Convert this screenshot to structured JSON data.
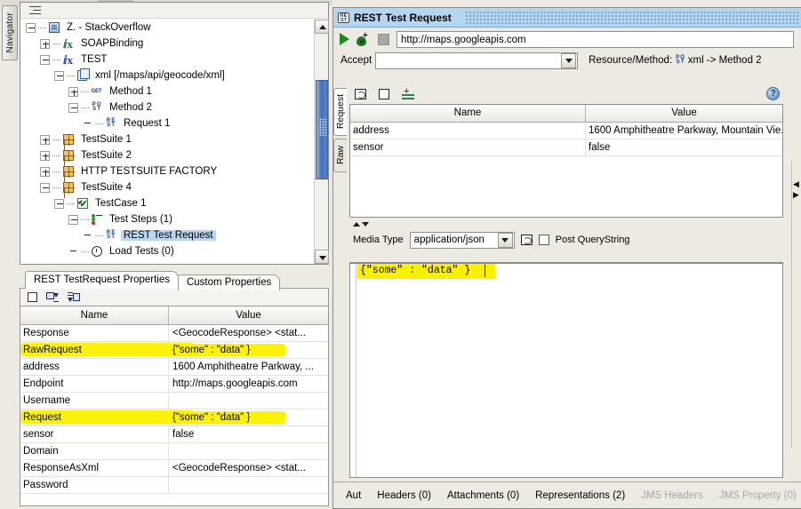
{
  "app": {
    "navigator_tab": "Navigator"
  },
  "tree": {
    "items": [
      {
        "label": "Z. - StackOverflow",
        "icon": "project-icon",
        "indent": 0,
        "expander": "minus",
        "selected": false
      },
      {
        "label": "SOAPBinding",
        "icon": "interface-icon",
        "indent": 1,
        "expander": "plus",
        "selected": false
      },
      {
        "label": "TEST",
        "icon": "interface-icon-blue",
        "indent": 1,
        "expander": "minus",
        "selected": false
      },
      {
        "label": "xml [/maps/api/geocode/xml]",
        "icon": "resource-icon",
        "indent": 2,
        "expander": "minus",
        "selected": false
      },
      {
        "label": "Method 1",
        "icon": "get-method-icon",
        "indent": 3,
        "expander": "plus",
        "selected": false
      },
      {
        "label": "Method 2",
        "icon": "post-method-icon",
        "indent": 3,
        "expander": "minus",
        "selected": false
      },
      {
        "label": "Request 1",
        "icon": "rest-request-icon",
        "indent": 4,
        "expander": "none",
        "selected": false
      },
      {
        "label": "TestSuite 1",
        "icon": "testsuite-icon",
        "indent": 1,
        "expander": "plus",
        "selected": false
      },
      {
        "label": "TestSuite 2",
        "icon": "testsuite-icon",
        "indent": 1,
        "expander": "plus",
        "selected": false
      },
      {
        "label": "HTTP TESTSUITE FACTORY",
        "icon": "testsuite-icon",
        "indent": 1,
        "expander": "plus",
        "selected": false
      },
      {
        "label": "TestSuite 4",
        "icon": "testsuite-icon",
        "indent": 1,
        "expander": "minus",
        "selected": false
      },
      {
        "label": "TestCase 1",
        "icon": "testcase-icon",
        "indent": 2,
        "expander": "minus",
        "selected": false
      },
      {
        "label": "Test Steps (1)",
        "icon": "teststeps-icon",
        "indent": 3,
        "expander": "minus",
        "selected": false
      },
      {
        "label": "REST Test Request",
        "icon": "rest-request-icon",
        "indent": 4,
        "expander": "none",
        "selected": true
      },
      {
        "label": "Load Tests (0)",
        "icon": "loadtest-icon",
        "indent": 3,
        "expander": "none",
        "selected": false
      }
    ]
  },
  "properties": {
    "tabs": [
      {
        "label": "REST TestRequest Properties",
        "active": true
      },
      {
        "label": "Custom Properties",
        "active": false
      }
    ],
    "columns": {
      "name": "Name",
      "value": "Value"
    },
    "rows": [
      {
        "name": "Response",
        "value": "<GeocodeResponse>  <stat...",
        "highlight": false
      },
      {
        "name": "RawRequest",
        "value": "{\"some\" : \"data\" }",
        "highlight": true
      },
      {
        "name": "address",
        "value": "1600 Amphitheatre Parkway, ...",
        "highlight": false
      },
      {
        "name": "Endpoint",
        "value": "http://maps.googleapis.com",
        "highlight": false
      },
      {
        "name": "Username",
        "value": "",
        "highlight": false
      },
      {
        "name": "Request",
        "value": "{\"some\" : \"data\" }",
        "highlight": true
      },
      {
        "name": "sensor",
        "value": "false",
        "highlight": false
      },
      {
        "name": "Domain",
        "value": "",
        "highlight": false
      },
      {
        "name": "ResponseAsXml",
        "value": "<GeocodeResponse>  <stat...",
        "highlight": false
      },
      {
        "name": "Password",
        "value": "",
        "highlight": false
      }
    ]
  },
  "request_window": {
    "title": "REST Test Request",
    "title_icon": "rest-icon",
    "endpoint": "http://maps.googleapis.com",
    "accept_label": "Accept",
    "accept_value": "",
    "resource_method_label": "Resource/Method:",
    "resource_method_value": "xml -> Method 2",
    "vertical_tabs": [
      {
        "label": "Request",
        "active": true
      },
      {
        "label": "Raw",
        "active": false
      }
    ],
    "params_table": {
      "columns": {
        "name": "Name",
        "value": "Value"
      },
      "rows": [
        {
          "name": "address",
          "value": "1600 Amphitheatre Parkway, Mountain Vie..."
        },
        {
          "name": "sensor",
          "value": "false"
        }
      ]
    },
    "media_type_label": "Media Type",
    "media_type_value": "application/json",
    "post_querystring_label": "Post QueryString",
    "post_querystring_checked": false,
    "editor_content": "{\"some\" : \"data\" }",
    "help_glyph": "?",
    "bottom_tabs": [
      {
        "label": "Aut",
        "dim": false
      },
      {
        "label": "Headers (0)",
        "dim": false
      },
      {
        "label": "Attachments (0)",
        "dim": false
      },
      {
        "label": "Representations (2)",
        "dim": false
      },
      {
        "label": "JMS Headers",
        "dim": true
      },
      {
        "label": "JMS Property (0)",
        "dim": true
      }
    ]
  },
  "colors": {
    "title_bar": "#b4d5ef",
    "selection": "#b8d6f0",
    "highlight_marker": "#fbf000",
    "scrollbar_thumb": "#4a72b8"
  }
}
